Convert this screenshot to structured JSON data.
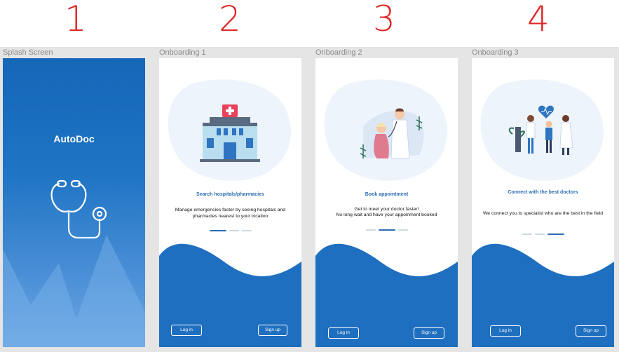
{
  "step_numbers": [
    "1",
    "2",
    "3",
    "4"
  ],
  "frames": {
    "splash": {
      "label": "Splash Screen",
      "app_name": "AutoDoc",
      "icon": "stethoscope-icon"
    },
    "onboarding1": {
      "label": "Onboarding 1",
      "illustration": "hospital-illustration",
      "title": "Search hospitals/pharmacies",
      "description": "Manage emergencies faster by seeing hospitals and pharmacies nearest to your location",
      "login": "Log in",
      "signup": "Sign up"
    },
    "onboarding2": {
      "label": "Onboarding 2",
      "illustration": "doctor-patient-illustration",
      "title": "Book appointment",
      "description_line1": "Get to meet your doctor faster!",
      "description_line2": "No long wait and have your appoinment booked",
      "login": "Log in",
      "signup": "Sign up"
    },
    "onboarding3": {
      "label": "Onboarding 3",
      "illustration": "doctors-team-illustration",
      "title": "Connect with the best doctors",
      "description": "We connect you to specialist who are the best in the field",
      "login": "Log in",
      "signup": "Sign up"
    }
  },
  "colors": {
    "primary": "#1f6fc0",
    "accent_text": "#2b6db4",
    "step_numbers": "#e02424",
    "canvas": "#e5e5e5"
  }
}
